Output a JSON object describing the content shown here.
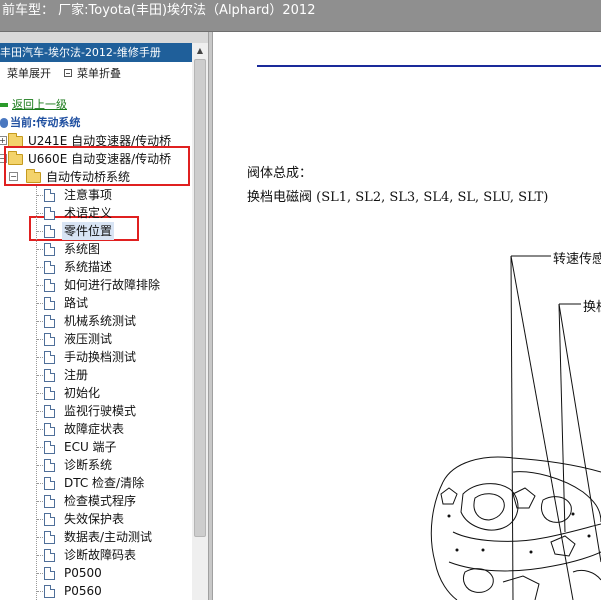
{
  "title_bar": {
    "text": "前车型： 厂家:Toyota(丰田)埃尔法（Alphard）2012"
  },
  "left_pane": {
    "header": "丰田汽车-埃尔法-2012-维修手册",
    "toolbar": {
      "expand_label": "菜单展开",
      "collapse_label": "菜单折叠"
    },
    "back_link": "返回上一级",
    "current_label": "当前:传动系统",
    "folders": [
      {
        "label": "U241E 自动变速器/传动桥"
      },
      {
        "label": "U660E 自动变速器/传动桥"
      },
      {
        "label": "自动传动桥系统"
      }
    ],
    "items": [
      "注意事项",
      "术语定义",
      "零件位置",
      "系统图",
      "系统描述",
      "如何进行故障排除",
      "路试",
      "机械系统测试",
      "液压测试",
      "手动换档测试",
      "注册",
      "初始化",
      "监视行驶模式",
      "故障症状表",
      "ECU 端子",
      "诊断系统",
      "DTC 检查/清除",
      "检查模式程序",
      "失效保护表",
      "数据表/主动测试",
      "诊断故障码表",
      "P0500",
      "P0560"
    ],
    "selected_item": "零件位置"
  },
  "document": {
    "line1": "阀体总成：",
    "line2": "换档电磁阀 (SL1, SL2, SL3, SL4, SL, SLU, SLT)",
    "callout1": "转速传感",
    "callout2": "换档"
  },
  "colors": {
    "title_bar_bg": "#8f8f8f",
    "header_bg": "#1f5f9a",
    "highlight_red": "#e02020",
    "doc_rule": "#1a2a9a"
  }
}
